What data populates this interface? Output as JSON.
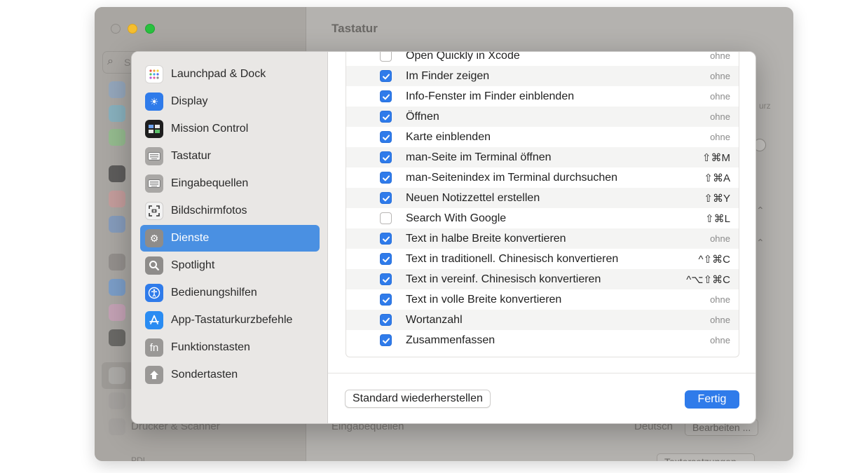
{
  "window": {
    "title": "Tastatur",
    "search_placeholder": "S",
    "bg_sidebar_items": [
      "Drucker & Scanner",
      "PDI"
    ],
    "bg_rows": [
      {
        "label": "Eingabequellen",
        "value": "Deutsch",
        "button": "Bearbeiten ..."
      }
    ],
    "bg_button_bottom": "Textersetzungen ...",
    "bg_side_text": "urz"
  },
  "sidebar": {
    "items": [
      {
        "label": "Launchpad & Dock",
        "icon": "launchpad-icon"
      },
      {
        "label": "Display",
        "icon": "display-icon"
      },
      {
        "label": "Mission Control",
        "icon": "mission-control-icon"
      },
      {
        "label": "Tastatur",
        "icon": "keyboard-icon"
      },
      {
        "label": "Eingabequellen",
        "icon": "input-sources-icon"
      },
      {
        "label": "Bildschirmfotos",
        "icon": "screenshot-icon"
      },
      {
        "label": "Dienste",
        "icon": "services-gear-icon",
        "selected": true
      },
      {
        "label": "Spotlight",
        "icon": "spotlight-icon"
      },
      {
        "label": "Bedienungshilfen",
        "icon": "accessibility-icon"
      },
      {
        "label": "App-Tastaturkurzbefehle",
        "icon": "app-shortcuts-icon"
      },
      {
        "label": "Funktionstasten",
        "icon": "function-keys-icon"
      },
      {
        "label": "Sondertasten",
        "icon": "modifier-keys-icon"
      }
    ]
  },
  "services": [
    {
      "label": "Open Quickly in Xcode",
      "checked": false,
      "shortcut": "ohne"
    },
    {
      "label": "Im Finder zeigen",
      "checked": true,
      "shortcut": "ohne"
    },
    {
      "label": "Info-Fenster im Finder einblenden",
      "checked": true,
      "shortcut": "ohne"
    },
    {
      "label": "Öffnen",
      "checked": true,
      "shortcut": "ohne"
    },
    {
      "label": "Karte einblenden",
      "checked": true,
      "shortcut": "ohne"
    },
    {
      "label": "man-Seite im Terminal öffnen",
      "checked": true,
      "shortcut": "⇧⌘M"
    },
    {
      "label": "man-Seitenindex im Terminal durchsuchen",
      "checked": true,
      "shortcut": "⇧⌘A"
    },
    {
      "label": "Neuen Notizzettel erstellen",
      "checked": true,
      "shortcut": "⇧⌘Y"
    },
    {
      "label": "Search With Google",
      "checked": false,
      "shortcut": "⇧⌘L"
    },
    {
      "label": "Text in halbe Breite konvertieren",
      "checked": true,
      "shortcut": "ohne"
    },
    {
      "label": "Text in traditionell. Chinesisch konvertieren",
      "checked": true,
      "shortcut": "^⇧⌘C"
    },
    {
      "label": "Text in vereinf. Chinesisch konvertieren",
      "checked": true,
      "shortcut": "^⌥⇧⌘C"
    },
    {
      "label": "Text in volle Breite konvertieren",
      "checked": true,
      "shortcut": "ohne"
    },
    {
      "label": "Wortanzahl",
      "checked": true,
      "shortcut": "ohne"
    },
    {
      "label": "Zusammenfassen",
      "checked": true,
      "shortcut": "ohne"
    }
  ],
  "buttons": {
    "restore": "Standard wiederherstellen",
    "done": "Fertig"
  },
  "colors": {
    "accent": "#2f7bea",
    "selected_sidebar": "#4a90e2"
  }
}
